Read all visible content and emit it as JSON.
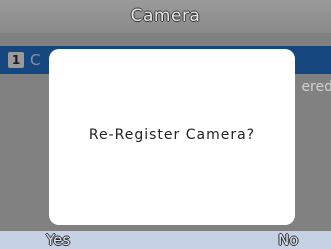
{
  "header": {
    "title": "Camera"
  },
  "list": {
    "selected_item_number": "1",
    "selected_item_label_partial": "C",
    "status_partial": "ered"
  },
  "dialog": {
    "message": "Re-Register Camera?"
  },
  "softkeys": {
    "left_label": "Yes",
    "right_label": "No"
  },
  "colors": {
    "title_bar": "#8f8f8f",
    "background": "#818181",
    "selected_row": "#16477f",
    "dialog_background": "#ffffff",
    "softkey_bar": "#c7d1e6"
  }
}
